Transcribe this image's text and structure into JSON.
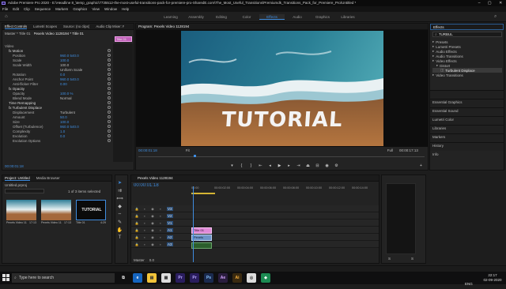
{
  "window": {
    "title": "Adobe Premiere Pro 2020 - E:\\Headline 8_\\temp_graphic\\7735512-the-most-useful-transitions-pack-for-premiere-pro-SharedE.com\\The_Most_Useful_Transitions\\Premiumdk_Transitions_Pack_for_Premiere_Pro\\Untitled *"
  },
  "menu": [
    "File",
    "Edit",
    "Clip",
    "Sequence",
    "Markers",
    "Graphics",
    "View",
    "Window",
    "Help"
  ],
  "workspaces": [
    "Learning",
    "Assembly",
    "Editing",
    "Color",
    "Effects",
    "Audio",
    "Graphics",
    "Libraries"
  ],
  "active_workspace": "Effects",
  "effect_controls": {
    "tabs": [
      "Effect Controls",
      "Lumetri Scopes",
      "Source: (no clips)",
      "Audio Clip Mixer: Pexels Video..."
    ],
    "path": "Master * Title 01",
    "seq": "Pexels Video 1128194 * Title 01",
    "clip_label": "Title 01",
    "rows": [
      {
        "label": "Video",
        "val": "",
        "indent": 0,
        "blue": false
      },
      {
        "label": "fx Motion",
        "val": "",
        "indent": 1,
        "blue": false
      },
      {
        "label": "Position",
        "val": "960.0   540.0",
        "indent": 2,
        "blue": true
      },
      {
        "label": "Scale",
        "val": "100.0",
        "indent": 2,
        "blue": true
      },
      {
        "label": "Scale Width",
        "val": "100.0",
        "indent": 2,
        "blue": false
      },
      {
        "label": "",
        "val": "Uniform Scale",
        "indent": 2,
        "blue": false
      },
      {
        "label": "Rotation",
        "val": "0.0",
        "indent": 2,
        "blue": true
      },
      {
        "label": "Anchor Point",
        "val": "960.0   540.0",
        "indent": 2,
        "blue": true
      },
      {
        "label": "Anti-flicker Filter",
        "val": "0.00",
        "indent": 2,
        "blue": true
      },
      {
        "label": "fx Opacity",
        "val": "",
        "indent": 1,
        "blue": false
      },
      {
        "label": "Opacity",
        "val": "100.0 %",
        "indent": 2,
        "blue": true
      },
      {
        "label": "Blend Mode",
        "val": "Normal",
        "indent": 2,
        "blue": false
      },
      {
        "label": "Time Remapping",
        "val": "",
        "indent": 1,
        "blue": false
      },
      {
        "label": "fx Turbulent Displace",
        "val": "",
        "indent": 1,
        "blue": false
      },
      {
        "label": "Displacement",
        "val": "Turbulent",
        "indent": 2,
        "blue": false
      },
      {
        "label": "Amount",
        "val": "50.0",
        "indent": 2,
        "blue": true
      },
      {
        "label": "Size",
        "val": "100.0",
        "indent": 2,
        "blue": true
      },
      {
        "label": "Offset (Turbulence)",
        "val": "960.0   540.0",
        "indent": 2,
        "blue": true
      },
      {
        "label": "Complexity",
        "val": "1.0",
        "indent": 2,
        "blue": true
      },
      {
        "label": "Evolution",
        "val": "0.0",
        "indent": 2,
        "blue": true
      },
      {
        "label": "Evolution Options",
        "val": "",
        "indent": 2,
        "blue": false
      }
    ],
    "timecode": "00:00:01:18"
  },
  "program": {
    "title": "Program: Pexels Video 1128194",
    "overlay_text": "TUTORIAL",
    "timecode_left": "00:00:01:18",
    "fit": "Fit",
    "quality": "Full",
    "timecode_right": "00:00:17:13"
  },
  "effects_panel": {
    "title": "Effects",
    "search": "TURBUL",
    "tree": [
      {
        "label": "Presets",
        "indent": 0
      },
      {
        "label": "Lumetri Presets",
        "indent": 0
      },
      {
        "label": "Audio Effects",
        "indent": 0
      },
      {
        "label": "Audio Transitions",
        "indent": 0
      },
      {
        "label": "Video Effects",
        "indent": 0
      },
      {
        "label": "Distort",
        "indent": 1
      },
      {
        "label": "Turbulent Displace",
        "indent": 2
      },
      {
        "label": "Video Transitions",
        "indent": 0
      }
    ],
    "sections": [
      "Essential Graphics",
      "Essential Sound",
      "Lumetri Color",
      "Libraries",
      "Markers",
      "History",
      "Info"
    ]
  },
  "project": {
    "tabs": [
      "Project: Untitled",
      "Media Browser"
    ],
    "file": "Untitled.prproj",
    "count": "1 of 3 items selected",
    "items": [
      {
        "name": "Pexels Video 112...",
        "dur": "17:13"
      },
      {
        "name": "Pexels Video 112...",
        "dur": "17:13"
      },
      {
        "name": "Title 01",
        "dur": "4:29",
        "thumb_text": "TUTORIAL"
      }
    ]
  },
  "timeline": {
    "title": "Pexels Video 1128194",
    "timecode": "00:00:01:18",
    "ruler": [
      "00:00",
      "00:00:02:00",
      "00:00:04:00",
      "00:00:06:00",
      "00:00:08:00",
      "00:00:10:00",
      "00:00:12:00",
      "00:00:14:00"
    ],
    "video_tracks": [
      "V3",
      "V2",
      "V1"
    ],
    "audio_tracks": [
      "A1",
      "A2",
      "A3"
    ],
    "clips": {
      "v2": "Title 01",
      "v1": "Pexels Video"
    },
    "master": "Master",
    "master_val": "0.0"
  },
  "meter": {
    "labels": [
      "S",
      "S"
    ]
  },
  "taskbar": {
    "search": "Type here to search",
    "time": "22:17",
    "date": "02-09-2020",
    "lang": "ENG"
  },
  "colors": {
    "accent": "#3f8de0",
    "clip_pink": "#e08ad8",
    "clip_blue": "#6e94c8",
    "sand": "#a4683c",
    "ocean": "#1f6a85"
  }
}
